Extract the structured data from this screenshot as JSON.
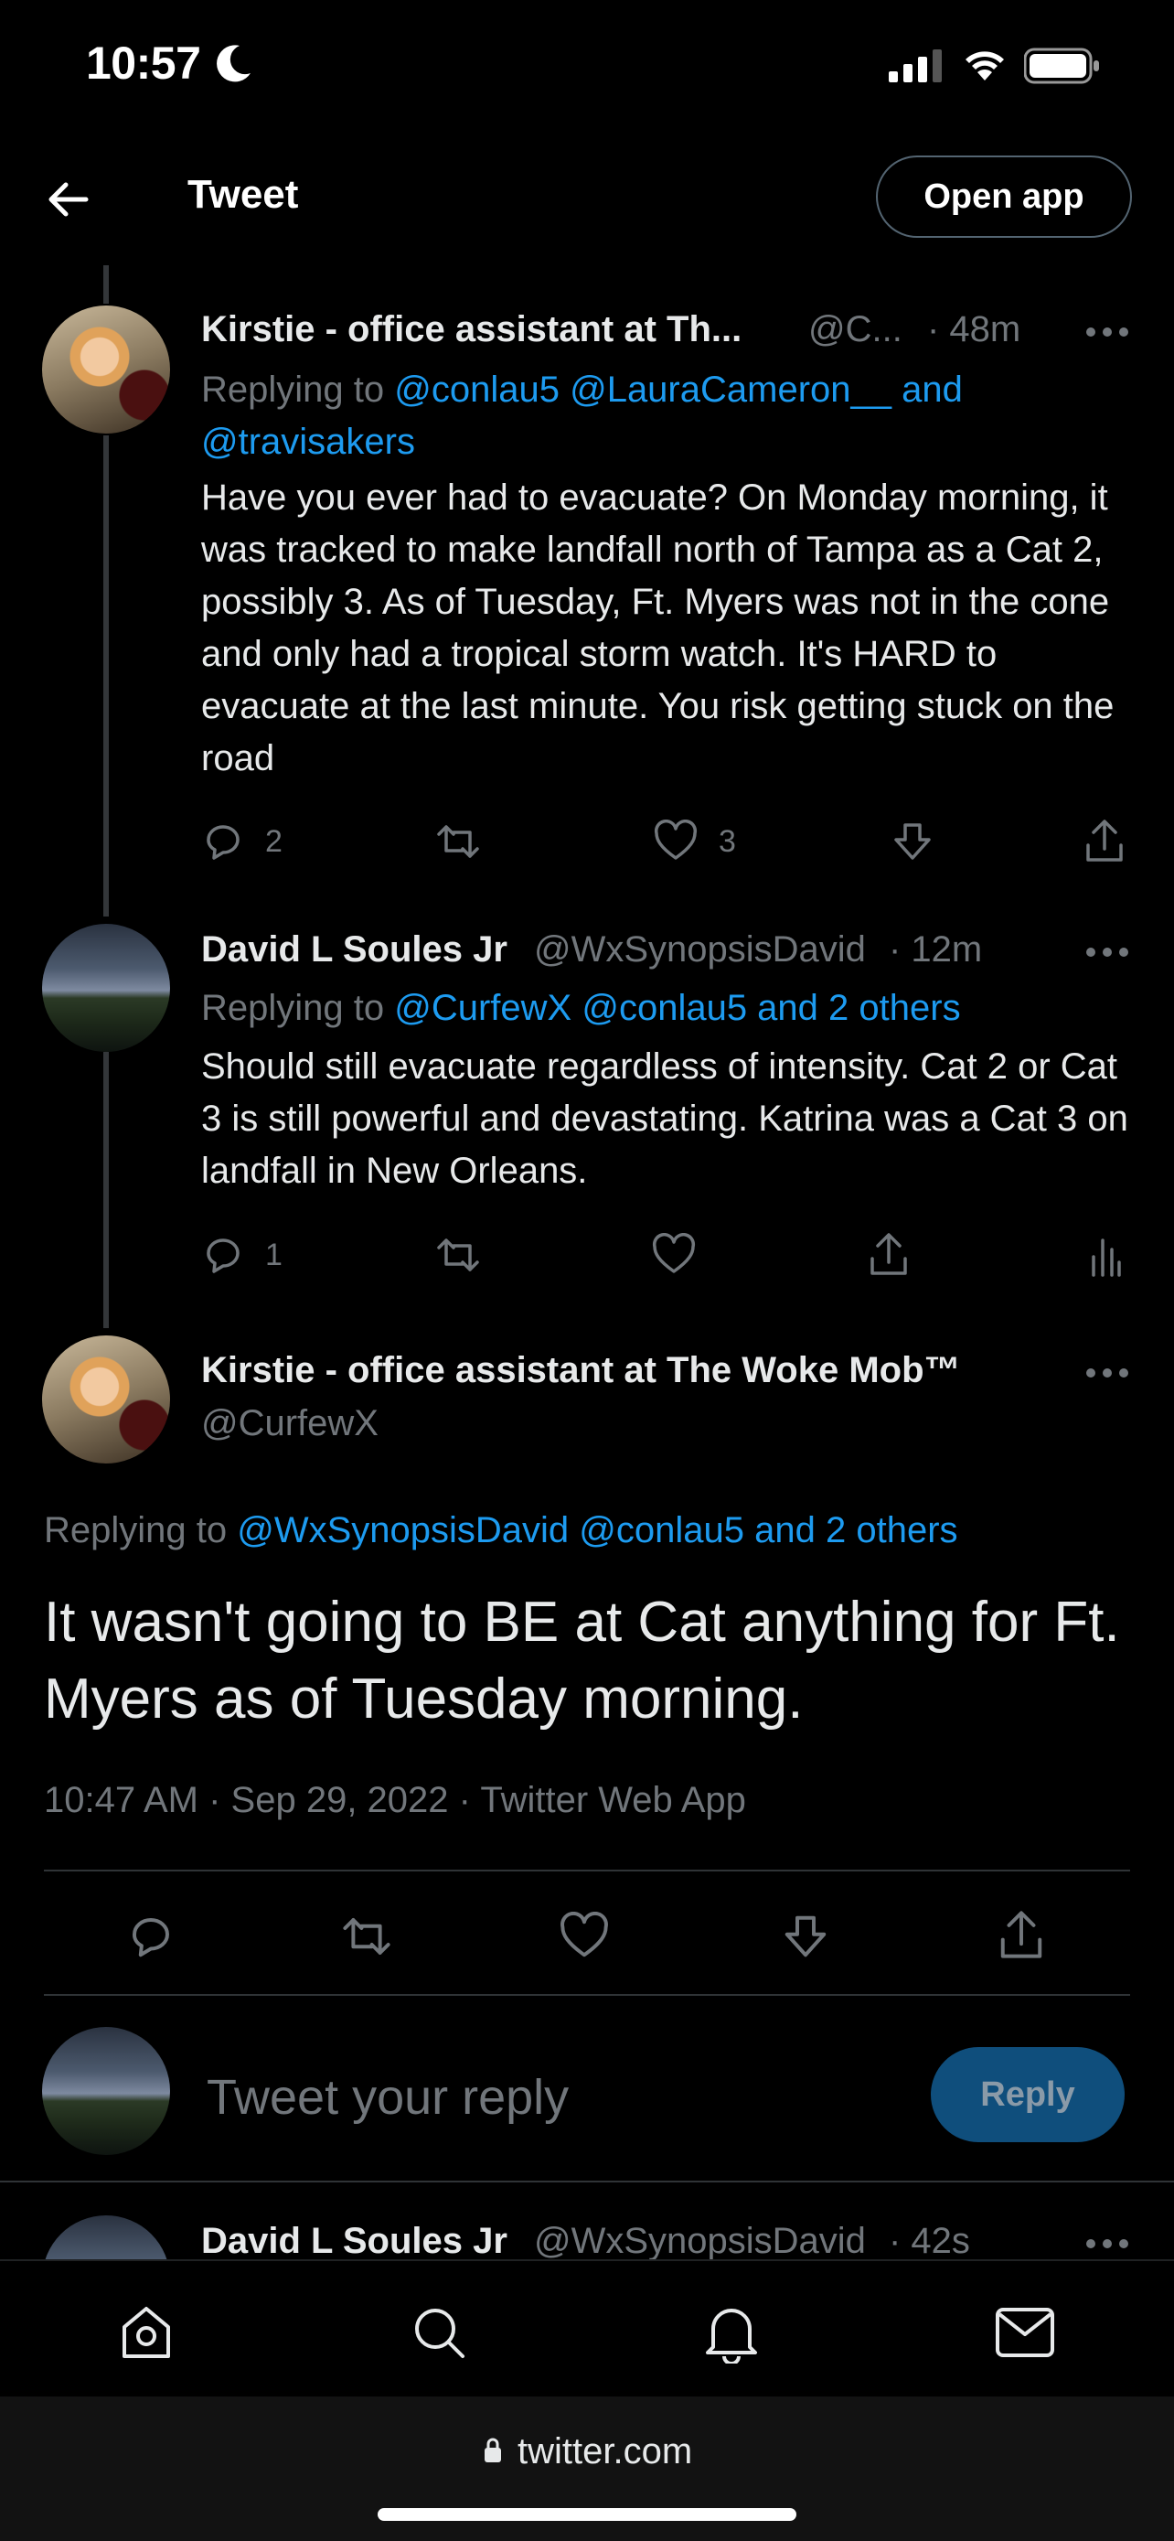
{
  "status_bar": {
    "time": "10:57"
  },
  "header": {
    "title": "Tweet",
    "open_app_label": "Open app"
  },
  "tweets": [
    {
      "name": "Kirstie - office assistant at Th...",
      "handle": "@C...",
      "time": "· 48m",
      "reply_prefix": "Replying to",
      "reply_targets": "@conlau5 @LauraCameron__ and",
      "reply_targets_2": "@travisakers",
      "text": "Have you ever had to evacuate? On Monday morning, it was tracked to make landfall north of Tampa as a Cat 2, possibly 3. As of Tuesday, Ft. Myers was not in the cone and only had a tropical storm watch. It's HARD to evacuate at the last minute. You risk getting stuck on the road",
      "replies": "2",
      "likes": "3"
    },
    {
      "name": "David L Soules Jr",
      "handle": "@WxSynopsisDavid",
      "time": "· 12m",
      "reply_prefix": "Replying to",
      "reply_targets": "@CurfewX @conlau5 and 2 others",
      "text": "Should still evacuate regardless of intensity. Cat 2 or Cat 3 is still powerful and devastating. Katrina was a Cat 3 on landfall in New Orleans.",
      "replies": "1"
    }
  ],
  "main_tweet": {
    "name": "Kirstie - office assistant at The Woke Mob™",
    "handle": "@CurfewX",
    "reply_prefix": "Replying to",
    "reply_targets": "@WxSynopsisDavid @conlau5 and 2 others",
    "text": "It wasn't going to BE at Cat anything for Ft. Myers as of Tuesday morning.",
    "timestamp": "10:47 AM · Sep 29, 2022 · Twitter Web App"
  },
  "reply_box": {
    "placeholder": "Tweet your reply",
    "button": "Reply"
  },
  "next_tweet": {
    "name": "David L Soules Jr",
    "handle": "@WxSynopsisDavid",
    "time": "· 42s"
  },
  "browser": {
    "url": "twitter.com"
  },
  "colors": {
    "background": "#000000",
    "accent": "#1d9bf0",
    "muted": "#71767b"
  }
}
